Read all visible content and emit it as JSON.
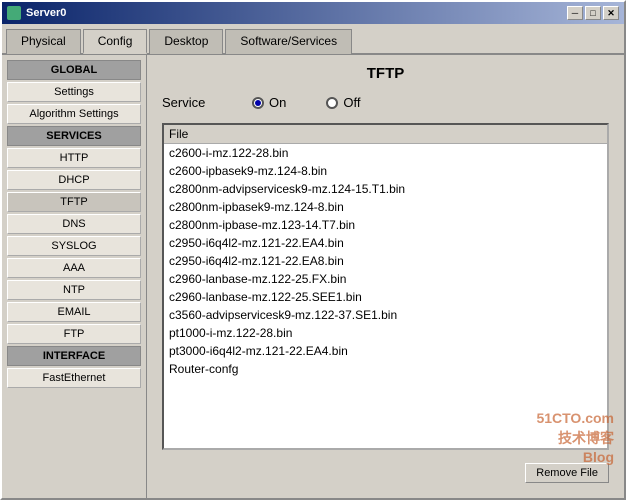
{
  "window": {
    "title": "Server0",
    "min_btn": "─",
    "max_btn": "□",
    "close_btn": "✕"
  },
  "tabs": [
    {
      "id": "physical",
      "label": "Physical"
    },
    {
      "id": "config",
      "label": "Config"
    },
    {
      "id": "desktop",
      "label": "Desktop"
    },
    {
      "id": "software",
      "label": "Software/Services"
    }
  ],
  "active_tab": "config",
  "sidebar": {
    "global_header": "GLOBAL",
    "items_global": [
      {
        "id": "settings",
        "label": "Settings"
      },
      {
        "id": "algorithm-settings",
        "label": "Algorithm Settings"
      }
    ],
    "services_header": "SERVICES",
    "items_services": [
      {
        "id": "http",
        "label": "HTTP"
      },
      {
        "id": "dhcp",
        "label": "DHCP"
      },
      {
        "id": "tftp",
        "label": "TFTP"
      },
      {
        "id": "dns",
        "label": "DNS"
      },
      {
        "id": "syslog",
        "label": "SYSLOG"
      },
      {
        "id": "aaa",
        "label": "AAA"
      },
      {
        "id": "ntp",
        "label": "NTP"
      },
      {
        "id": "email",
        "label": "EMAIL"
      },
      {
        "id": "ftp",
        "label": "FTP"
      }
    ],
    "interface_header": "INTERFACE",
    "items_interface": [
      {
        "id": "fastethernet",
        "label": "FastEthernet"
      }
    ]
  },
  "main": {
    "panel_title": "TFTP",
    "service_label": "Service",
    "radio_on": "On",
    "radio_off": "Off",
    "file_column_header": "File",
    "files": [
      "c2600-i-mz.122-28.bin",
      "c2600-ipbasek9-mz.124-8.bin",
      "c2800nm-advipservicesk9-mz.124-15.T1.bin",
      "c2800nm-ipbasek9-mz.124-8.bin",
      "c2800nm-ipbase-mz.123-14.T7.bin",
      "c2950-i6q4l2-mz.121-22.EA4.bin",
      "c2950-i6q4l2-mz.121-22.EA8.bin",
      "c2960-lanbase-mz.122-25.FX.bin",
      "c2960-lanbase-mz.122-25.SEE1.bin",
      "c3560-advipservicesk9-mz.122-37.SE1.bin",
      "pt1000-i-mz.122-28.bin",
      "pt3000-i6q4l2-mz.121-22.EA4.bin",
      "Router-confg"
    ],
    "remove_file_btn": "Remove File"
  },
  "watermark": {
    "line1": "51CTO.com",
    "line2": "技术博客",
    "line3": "Blog"
  }
}
